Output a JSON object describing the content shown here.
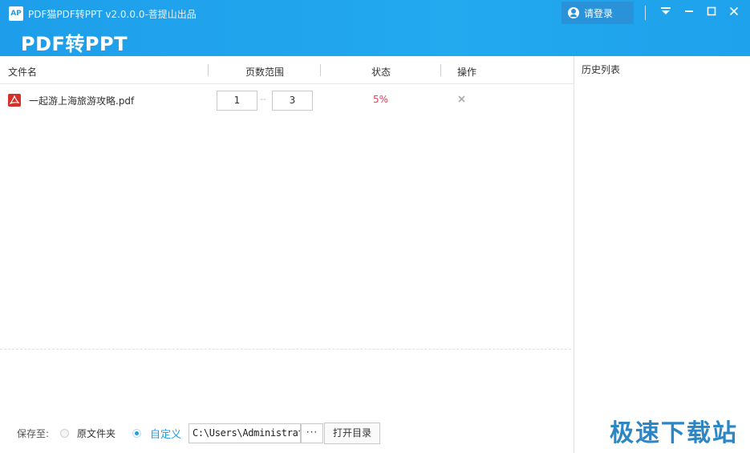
{
  "window": {
    "title": "PDF猫PDF转PPT v2.0.0.0-菩提山出品",
    "app_icon_text": "AP",
    "big_title": "PDF转PPT"
  },
  "header": {
    "login_label": "请登录",
    "controls": {
      "menu_glyph": "⏷",
      "minimize_glyph": "—",
      "maximize_glyph": "☐",
      "close_glyph": "✕"
    }
  },
  "table": {
    "columns": [
      "文件名",
      "页数范围",
      "状态",
      "操作"
    ],
    "rows": [
      {
        "file_name": "一起游上海旅游攻略.pdf",
        "page_from": "1",
        "page_to": "3",
        "range_sep": "--",
        "status": "5%",
        "action_icon": "close-icon"
      }
    ]
  },
  "history": {
    "title": "历史列表"
  },
  "footer": {
    "save_to_label": "保存至:",
    "option_original": "原文件夹",
    "option_custom": "自定义",
    "selected_option": "custom",
    "path_value": "C:\\Users\\Administrator",
    "browse_label": "···",
    "open_dir_label": "打开目录"
  },
  "watermark": "极速下载站",
  "colors": {
    "header_blue": "#1e9eea",
    "status_red": "#e0405a",
    "accent": "#1e9eea"
  }
}
